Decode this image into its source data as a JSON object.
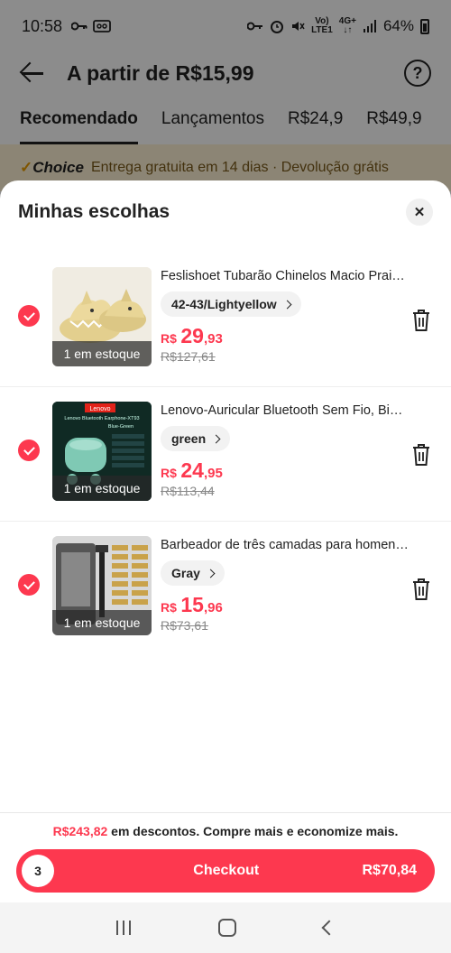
{
  "status_bar": {
    "time": "10:58",
    "battery": "64%"
  },
  "header": {
    "title": "A partir de R$15,99"
  },
  "tabs": [
    {
      "label": "Recomendado",
      "active": true
    },
    {
      "label": "Lançamentos"
    },
    {
      "label": "R$24,9"
    },
    {
      "label": "R$49,9"
    }
  ],
  "choice_bar": {
    "brand": "Choice",
    "text": "Entrega gratuita em 14 dias · Devolução grátis"
  },
  "sheet": {
    "title": "Minhas escolhas",
    "items": [
      {
        "name": "Feslishoet Tubarão Chinelos Macio Praia...",
        "variant": "42-43/Lightyellow",
        "stock": "1 em estoque",
        "price_currency": "R$",
        "price_int": "29",
        "price_dec": ",93",
        "old_price": "R$127,61",
        "selected": true
      },
      {
        "name": "Lenovo-Auricular Bluetooth Sem Fio, Binaural...",
        "variant": "green",
        "stock": "1 em estoque",
        "price_currency": "R$",
        "price_int": "24",
        "price_dec": ",95",
        "old_price": "R$113,44",
        "selected": true,
        "image_text": {
          "brand": "Lenovo",
          "line1": "Lenovo Bluetooth Earphone-XT93",
          "line2": "Blue-Green"
        }
      },
      {
        "name": "Barbeador de três camadas para homens,...",
        "variant": "Gray",
        "stock": "1 em estoque",
        "price_currency": "R$",
        "price_int": "15",
        "price_dec": ",96",
        "old_price": "R$73,61",
        "selected": true
      }
    ]
  },
  "footer": {
    "discount_amount": "R$243,82",
    "discount_text": " em descontos. Compre mais e economize mais.",
    "count": "3",
    "checkout_label": "Checkout",
    "total": "R$70,84"
  },
  "colors": {
    "accent": "#fd384f",
    "choice_bg": "#fff3d6"
  }
}
